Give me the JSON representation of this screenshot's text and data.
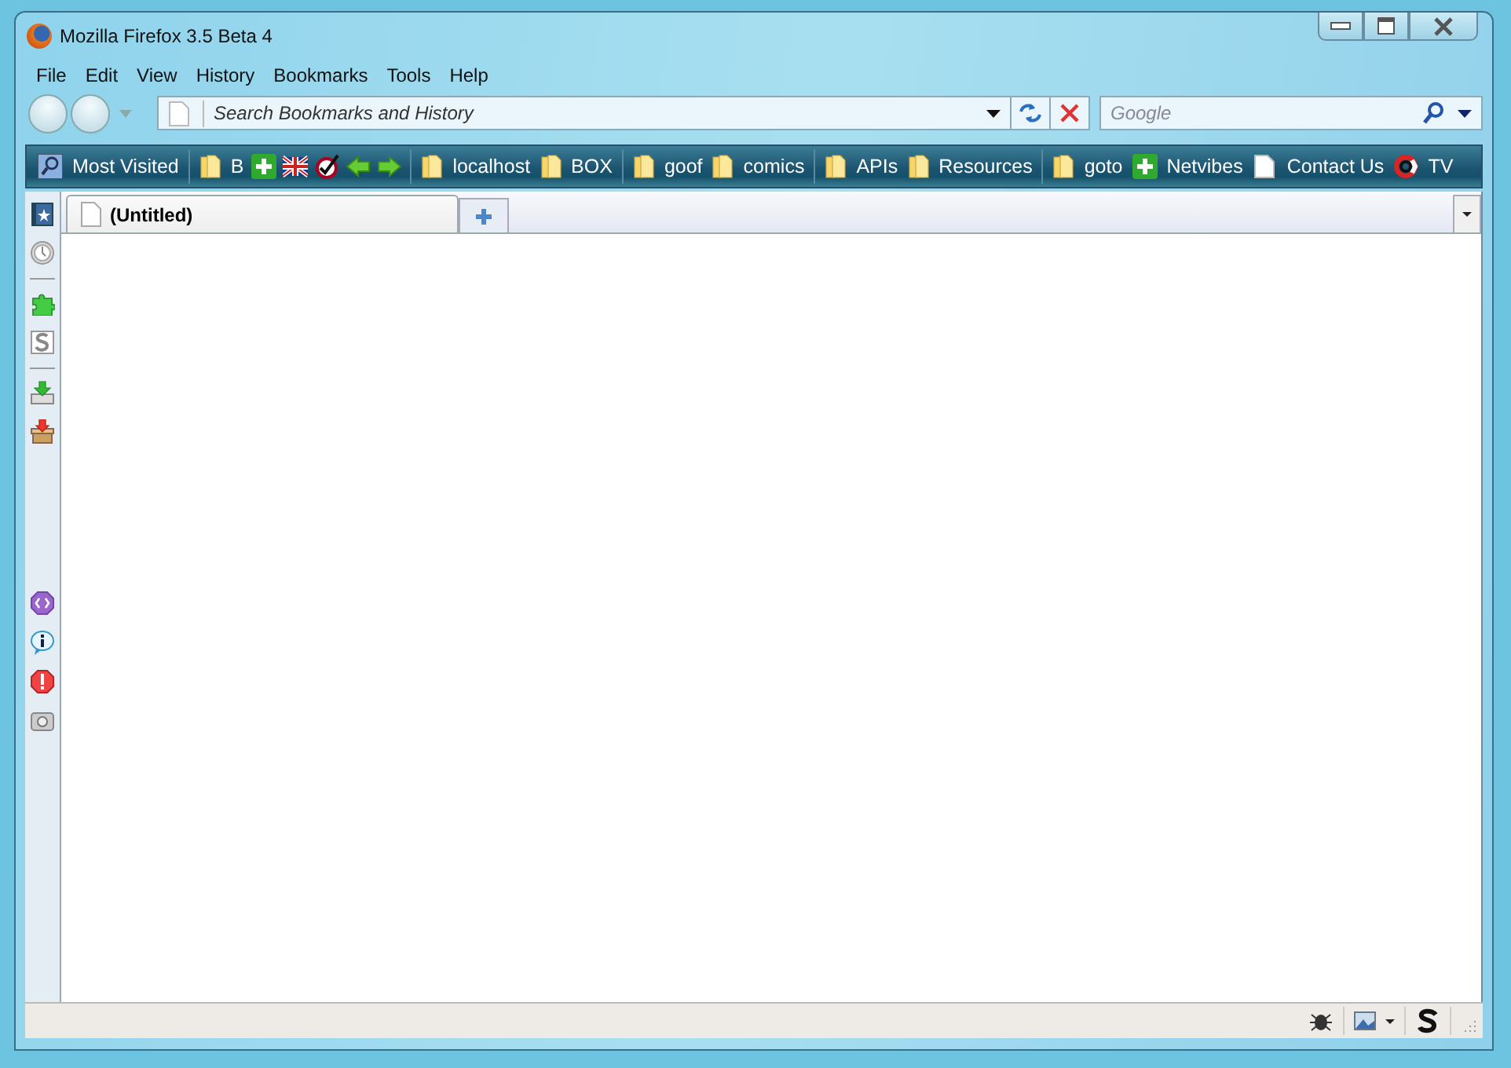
{
  "window": {
    "title": "Mozilla Firefox 3.5 Beta 4"
  },
  "menu": [
    "File",
    "Edit",
    "View",
    "History",
    "Bookmarks",
    "Tools",
    "Help"
  ],
  "address": {
    "placeholder": "Search Bookmarks and History"
  },
  "search": {
    "placeholder": "Google"
  },
  "bookmarks": [
    {
      "kind": "link",
      "label": "Most Visited"
    },
    {
      "kind": "separator"
    },
    {
      "kind": "folder",
      "label": "B"
    },
    {
      "kind": "icon"
    },
    {
      "kind": "icon"
    },
    {
      "kind": "icon"
    },
    {
      "kind": "icon"
    },
    {
      "kind": "icon"
    },
    {
      "kind": "separator"
    },
    {
      "kind": "folder",
      "label": "localhost"
    },
    {
      "kind": "folder",
      "label": "BOX"
    },
    {
      "kind": "separator"
    },
    {
      "kind": "folder",
      "label": "goof"
    },
    {
      "kind": "folder",
      "label": "comics"
    },
    {
      "kind": "separator"
    },
    {
      "kind": "folder",
      "label": "APIs"
    },
    {
      "kind": "folder",
      "label": "Resources"
    },
    {
      "kind": "separator"
    },
    {
      "kind": "folder",
      "label": "goto"
    },
    {
      "kind": "link",
      "label": "Netvibes"
    },
    {
      "kind": "link",
      "label": "Contact Us"
    },
    {
      "kind": "link",
      "label": "TV"
    }
  ],
  "tabs": [
    {
      "label": "(Untitled)",
      "selected": true
    }
  ]
}
